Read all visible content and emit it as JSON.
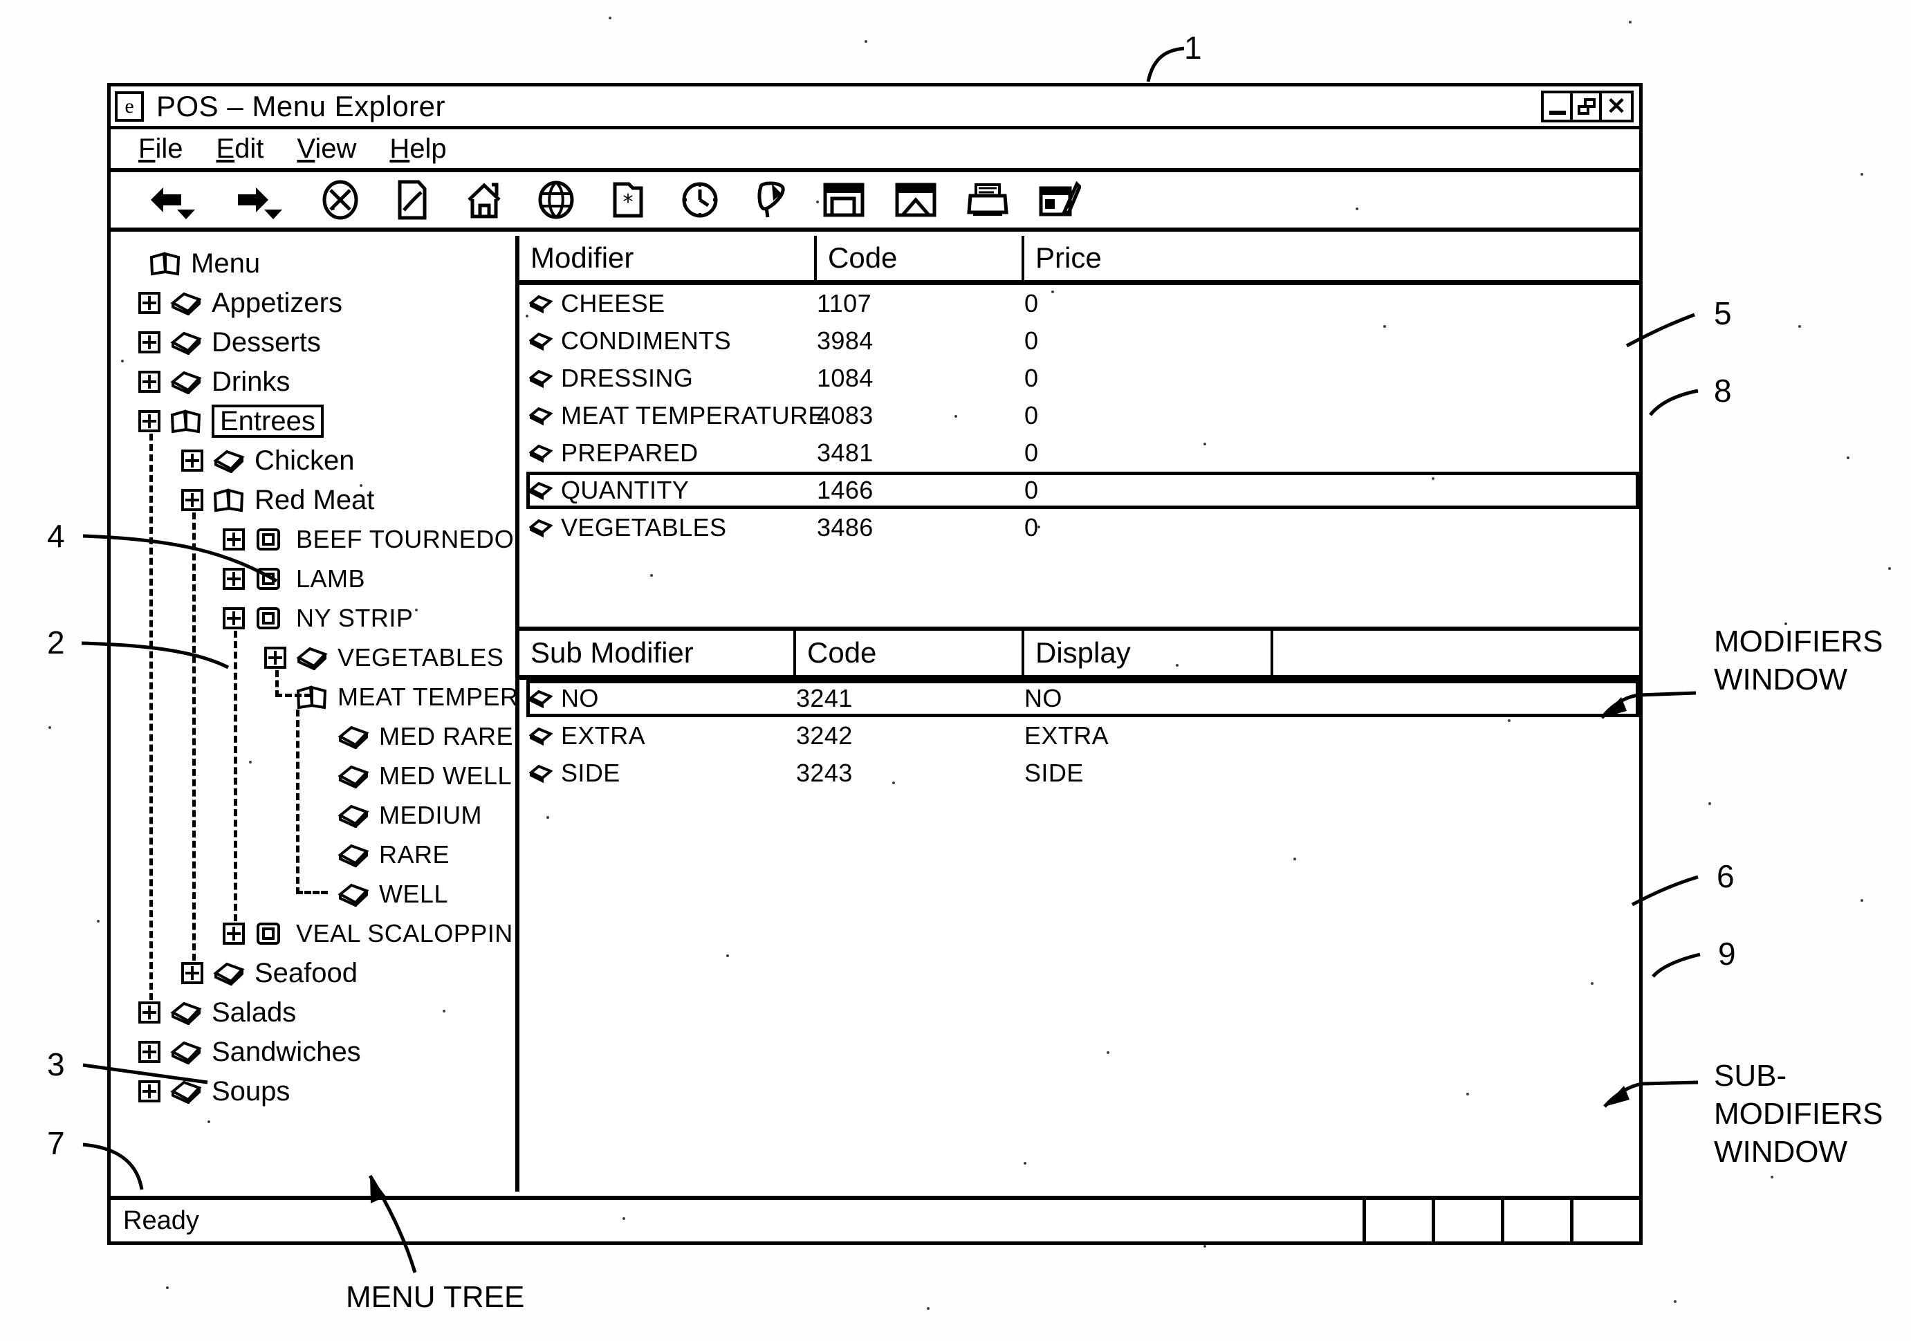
{
  "window": {
    "title": "POS – Menu Explorer",
    "app_icon": "e-logo-icon",
    "controls": {
      "minimize": "minimize-button",
      "restore": "restore-button",
      "close": "close-button"
    }
  },
  "menu_bar": {
    "items": [
      "File",
      "Edit",
      "View",
      "Help"
    ]
  },
  "toolbar": {
    "items": [
      {
        "name": "back-icon",
        "label": "Back"
      },
      {
        "name": "forward-icon",
        "label": "Forward"
      },
      {
        "name": "stop-icon",
        "label": "Stop"
      },
      {
        "name": "edit-document-icon",
        "label": "Edit"
      },
      {
        "name": "home-icon",
        "label": "Home"
      },
      {
        "name": "search-globe-icon",
        "label": "Search"
      },
      {
        "name": "new-item-icon",
        "label": "New"
      },
      {
        "name": "history-clock-icon",
        "label": "History"
      },
      {
        "name": "channels-icon",
        "label": "Channels"
      },
      {
        "name": "fullscreen-window-icon",
        "label": "Fullscreen"
      },
      {
        "name": "mail-icon",
        "label": "Mail"
      },
      {
        "name": "print-icon",
        "label": "Print"
      },
      {
        "name": "edit-list-icon",
        "label": "Edit List"
      }
    ]
  },
  "tree": {
    "nodes": [
      {
        "label": "Menu",
        "depth": 0,
        "icon": "open-book-icon",
        "expander": "none",
        "selected": false,
        "caps": false
      },
      {
        "label": "Appetizers",
        "depth": 1,
        "icon": "closed-book-icon",
        "expander": "plus",
        "selected": false,
        "caps": false
      },
      {
        "label": "Desserts",
        "depth": 1,
        "icon": "closed-book-icon",
        "expander": "plus",
        "selected": false,
        "caps": false
      },
      {
        "label": "Drinks",
        "depth": 1,
        "icon": "closed-book-icon",
        "expander": "plus",
        "selected": false,
        "caps": false
      },
      {
        "label": "Entrees",
        "depth": 1,
        "icon": "open-book-icon",
        "expander": "plus",
        "selected": true,
        "caps": false
      },
      {
        "label": "Chicken",
        "depth": 2,
        "icon": "closed-book-icon",
        "expander": "plus",
        "selected": false,
        "caps": false
      },
      {
        "label": "Red Meat",
        "depth": 2,
        "icon": "open-book-icon",
        "expander": "plus",
        "selected": false,
        "caps": false
      },
      {
        "label": "BEEF TOURNEDO",
        "depth": 3,
        "icon": "item-card-icon",
        "expander": "plus",
        "selected": false,
        "caps": true
      },
      {
        "label": "LAMB",
        "depth": 3,
        "icon": "item-card-icon",
        "expander": "plus",
        "selected": false,
        "caps": true
      },
      {
        "label": "NY STRIP",
        "depth": 3,
        "icon": "item-card-icon",
        "expander": "plus",
        "selected": false,
        "caps": true
      },
      {
        "label": "VEGETABLES",
        "depth": 4,
        "icon": "closed-book-icon",
        "expander": "plus",
        "selected": false,
        "caps": true
      },
      {
        "label": "MEAT TEMPERATURE",
        "depth": 4,
        "icon": "open-book-icon",
        "expander": "elbow",
        "selected": false,
        "caps": true
      },
      {
        "label": "MED RARE",
        "depth": 5,
        "icon": "closed-book-icon",
        "expander": "none",
        "selected": false,
        "caps": true
      },
      {
        "label": "MED WELL",
        "depth": 5,
        "icon": "closed-book-icon",
        "expander": "none",
        "selected": false,
        "caps": true
      },
      {
        "label": "MEDIUM",
        "depth": 5,
        "icon": "closed-book-icon",
        "expander": "none",
        "selected": false,
        "caps": true
      },
      {
        "label": "RARE",
        "depth": 5,
        "icon": "closed-book-icon",
        "expander": "none",
        "selected": false,
        "caps": true
      },
      {
        "label": "WELL",
        "depth": 5,
        "icon": "closed-book-icon",
        "expander": "elbow2",
        "selected": false,
        "caps": true
      },
      {
        "label": "VEAL SCALOPPINI",
        "depth": 3,
        "icon": "item-card-icon",
        "expander": "plus",
        "selected": false,
        "caps": true
      },
      {
        "label": "Seafood",
        "depth": 2,
        "icon": "closed-book-icon",
        "expander": "plus",
        "selected": false,
        "caps": false
      },
      {
        "label": "Salads",
        "depth": 1,
        "icon": "closed-book-icon",
        "expander": "plus",
        "selected": false,
        "caps": false
      },
      {
        "label": "Sandwiches",
        "depth": 1,
        "icon": "closed-book-icon",
        "expander": "plus",
        "selected": false,
        "caps": false
      },
      {
        "label": "Soups",
        "depth": 1,
        "icon": "closed-book-icon",
        "expander": "plus",
        "selected": false,
        "caps": false
      }
    ]
  },
  "modifiers": {
    "columns": [
      "Modifier",
      "Code",
      "Price"
    ],
    "rows": [
      {
        "modifier": "CHEESE",
        "code": "1107",
        "price": "0",
        "selected": false
      },
      {
        "modifier": "CONDIMENTS",
        "code": "3984",
        "price": "0",
        "selected": false
      },
      {
        "modifier": "DRESSING",
        "code": "1084",
        "price": "0",
        "selected": false
      },
      {
        "modifier": "MEAT TEMPERATURE",
        "code": "4083",
        "price": "0",
        "selected": false
      },
      {
        "modifier": "PREPARED",
        "code": "3481",
        "price": "0",
        "selected": false
      },
      {
        "modifier": "QUANTITY",
        "code": "1466",
        "price": "0",
        "selected": true
      },
      {
        "modifier": "VEGETABLES",
        "code": "3486",
        "price": "0",
        "selected": false
      }
    ]
  },
  "sub_modifiers": {
    "columns": [
      "Sub Modifier",
      "Code",
      "Display",
      ""
    ],
    "rows": [
      {
        "sub_modifier": "NO",
        "code": "3241",
        "display": "NO",
        "selected": true
      },
      {
        "sub_modifier": "EXTRA",
        "code": "3242",
        "display": "EXTRA",
        "selected": false
      },
      {
        "sub_modifier": "SIDE",
        "code": "3243",
        "display": "SIDE",
        "selected": false
      }
    ]
  },
  "status_bar": {
    "text": "Ready",
    "panels": [
      "",
      "",
      "",
      ""
    ]
  },
  "annotations": {
    "ref_1": "1",
    "ref_2": "2",
    "ref_3": "3",
    "ref_4": "4",
    "ref_5": "5",
    "ref_6": "6",
    "ref_7": "7",
    "ref_8": "8",
    "ref_9": "9",
    "label_modifiers_window": "MODIFIERS\nWINDOW",
    "label_sub_modifiers_window": "SUB-\nMODIFIERS\nWINDOW",
    "label_menu_tree": "MENU TREE"
  }
}
